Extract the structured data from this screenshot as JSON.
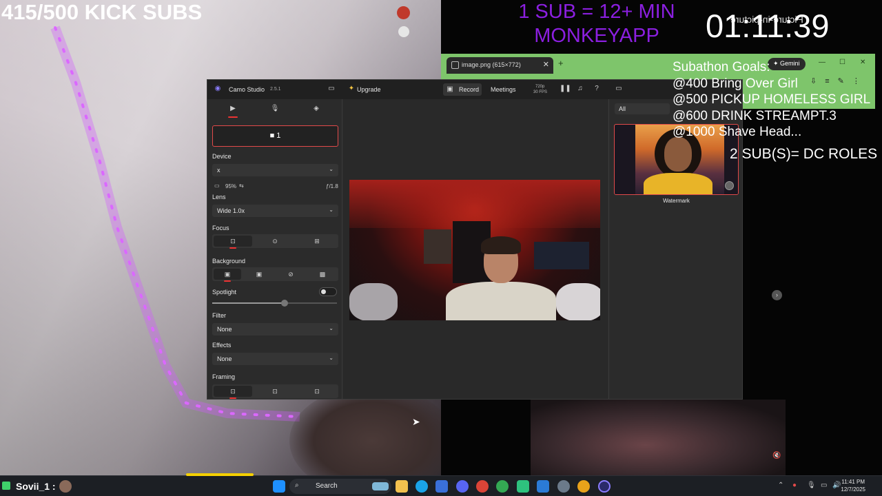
{
  "overlay": {
    "kick_subs": "415/500 KICK SUBS",
    "sub_rate_line1": "1 SUB = 12+ MIN",
    "sub_rate_line2": "MONKEYAPP",
    "timer": "01:11:39",
    "mirrored_text": "Picture-in-picture",
    "goals_title": "Subathon Goals:",
    "goals": [
      "@400 Bring Over Girl",
      "@500 PICKUP HOMELESS GIRL",
      "@600 DRINK STREAMPT.3",
      "@1000 Shave Head..."
    ],
    "dc_roles": "2 SUB(S)= DC ROLES"
  },
  "browser": {
    "tab_title": "image.png (615×772)",
    "gemini_label": "Gemini"
  },
  "camo": {
    "app_name": "Camo Studio",
    "version": "2.5.1",
    "upgrade_label": "Upgrade",
    "record_label": "Record",
    "meetings_label": "Meetings",
    "resolution": "720p",
    "fps": "30 FPS",
    "camera_slot_label": "1",
    "device_label": "Device",
    "device_value": "x",
    "battery": "95%",
    "aperture": "ƒ/1.8",
    "lens_label": "Lens",
    "lens_value": "Wide 1.0x",
    "focus_label": "Focus",
    "background_label": "Background",
    "spotlight_label": "Spotlight",
    "spotlight_level": 0.58,
    "filter_label": "Filter",
    "filter_value": "None",
    "effects_label": "Effects",
    "effects_value": "None",
    "framing_label": "Framing",
    "overlay_filter": "All",
    "watermark_label": "Watermark"
  },
  "taskbar": {
    "user_label": "Sovii_1 :",
    "search_placeholder": "Search",
    "time": "11:41 PM",
    "date": "12/7/2025"
  },
  "colors": {
    "purple_overlay": "#8b1fe0",
    "accent_red": "#e34a4a",
    "browser_green": "#7ec56b",
    "app_bg": "#2b2b2b"
  }
}
